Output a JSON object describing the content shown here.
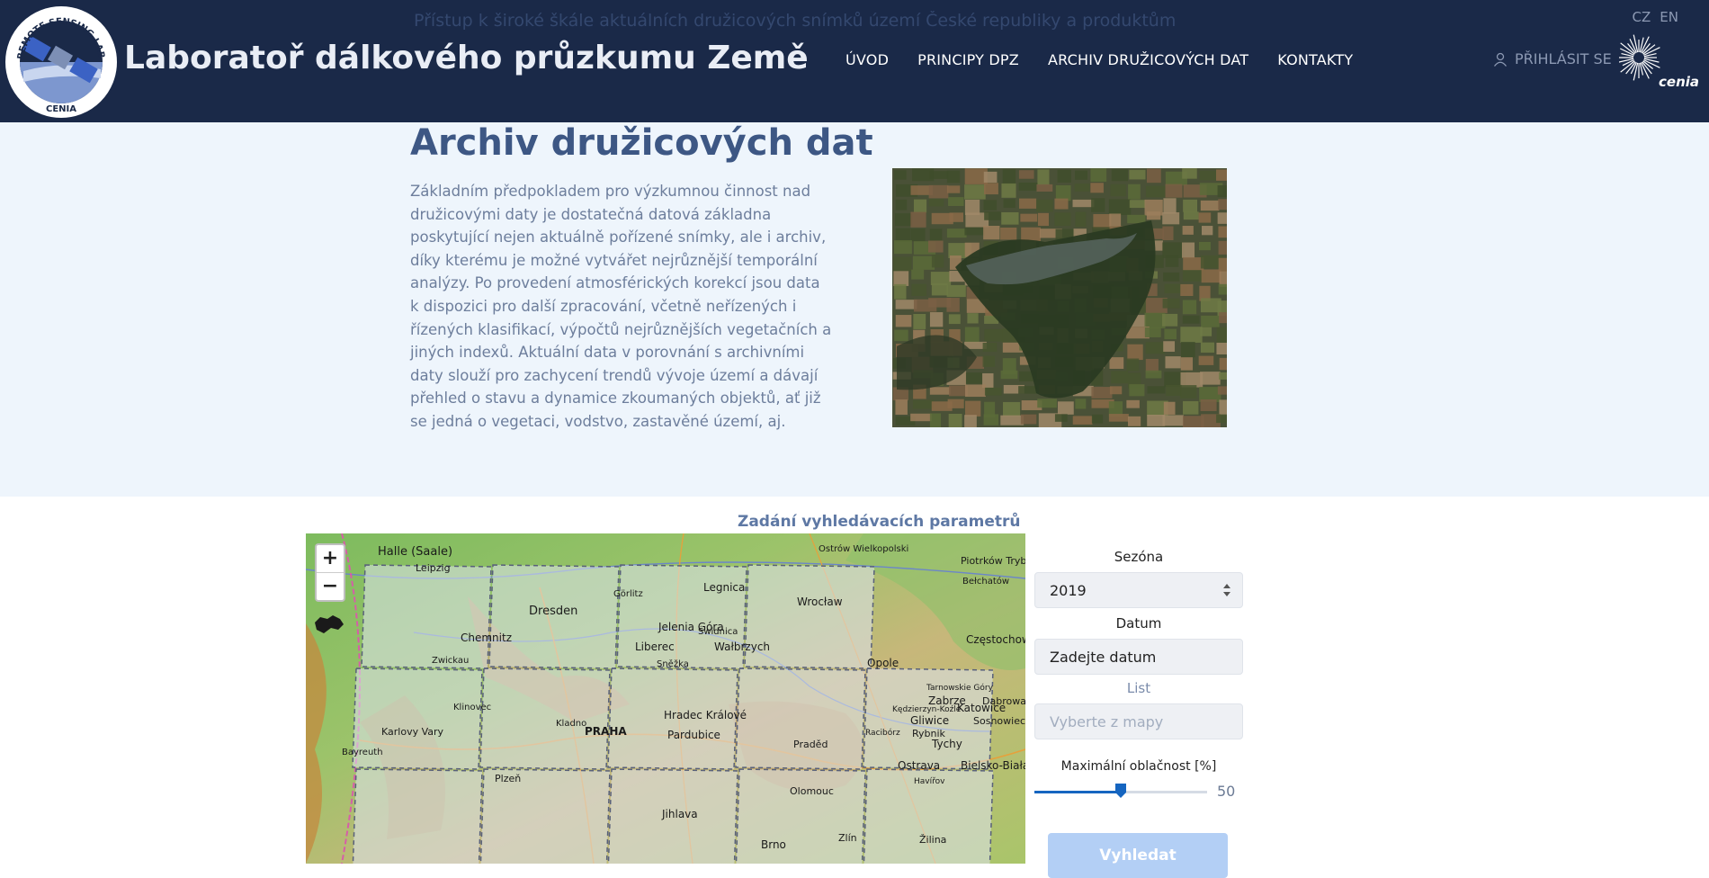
{
  "header": {
    "ghost_line_1": "Přístup k široké škále aktuálních družicových snímků území České republiky a produktům",
    "ghost_line_2": "",
    "brand_title": "Laboratoř dálkového průzkumu Země",
    "logo_text_top": "REMOTE SENSING LABORATORY",
    "logo_text_bottom": "CENIA",
    "nav": [
      "ÚVOD",
      "PRINCIPY DPZ",
      "ARCHIV DRUŽICOVÝCH DAT",
      "KONTAKTY"
    ],
    "lang": [
      "CZ",
      "EN"
    ],
    "login_label": "PŘIHLÁSIT SE",
    "partner_logo_text": "cenia"
  },
  "hero": {
    "title": "Archiv družicových dat",
    "body": "Základním předpokladem pro výzkumnou činnost nad družicovými daty je dostatečná datová základna poskytující nejen aktuálně pořízené snímky, ale i archiv, díky kterému je možné vytvářet nejrůznější temporální analýzy. Po provedení atmosférických korekcí jsou data k dispozici pro další zpracování, včetně neřízených i řízených klasifikací, výpočtů nejrůznějších vegetačních a jiných indexů. Aktuální data v porovnání s archivními daty slouží pro zachycení trendů vývoje území a dávají přehled o stavu a dynamice zkoumaných objektů, ať již se jedná o vegetaci, vodstvo, zastavěné území, aj."
  },
  "search": {
    "title": "Zadání vyhledávacích parametrů",
    "season_label": "Sezóna",
    "season_value": "2019",
    "date_label": "Datum",
    "date_placeholder": "Zadejte datum",
    "sheet_label": "List",
    "sheet_placeholder": "Vyberte z mapy",
    "cloud_label": "Maximální oblačnost [%]",
    "cloud_value": "50",
    "cloud_fraction": 0.5,
    "submit_label": "Vyhledat"
  },
  "map": {
    "zoom_in": "+",
    "zoom_out": "−",
    "cities": [
      "Halle (Saale)",
      "Leipzig",
      "Dresden",
      "Chemnitz",
      "Zwickau",
      "Görlitz",
      "Legnica",
      "Wrocław",
      "Ostrów Wielkopolski",
      "Piotrków Trybunalski",
      "Bełchatów",
      "Jelenia Góra",
      "Liberec",
      "Wałbrzych",
      "Świdnica",
      "Opole",
      "Częstochowa",
      "Karlovy Vary",
      "Kladno",
      "PRAHA",
      "Hradec Králové",
      "Pardubice",
      "Plzeň",
      "Bayreuth",
      "Zabrze",
      "Gliwice",
      "Katowice",
      "Sosnowiec",
      "Tychy",
      "Ostrava",
      "Bielsko-Biała",
      "Olomouc",
      "Jihlava",
      "Brno",
      "Zlín",
      "Žilina",
      "Praděd",
      "Sněžka",
      "Klinovec",
      "Rybnik",
      "Tarnowskie Góry",
      "Kędzierzyn-Koźle",
      "Racibórz",
      "Dąbrowa Górnicza",
      "Havířov"
    ],
    "colors": {
      "lowland": "#6fb35a",
      "highland": "#c9b77a",
      "sheet_overlay": "#dfe3f0"
    }
  },
  "colors": {
    "header_bg": "#1a2948",
    "hero_bg": "#eef5fc",
    "title": "#3d5784",
    "accent": "#1565c0",
    "button": "#b3cff5"
  }
}
